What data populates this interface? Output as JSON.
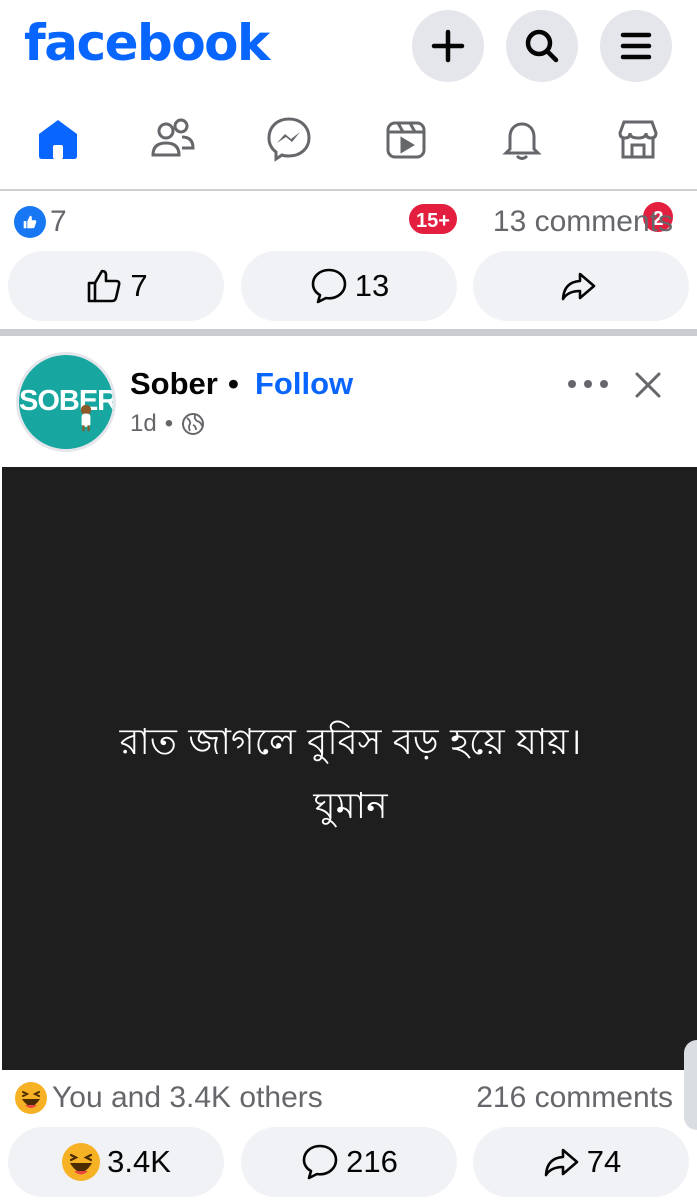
{
  "app": {
    "logo": "facebook"
  },
  "nav": {
    "reels_badge": "15+",
    "marketplace_badge": "2"
  },
  "prev_post": {
    "like_count": "7",
    "comments": "13 comments",
    "like_button": "7",
    "comment_button": "13"
  },
  "post": {
    "author": "Sober",
    "separator": "•",
    "follow": "Follow",
    "time": "1d",
    "meta_sep": "•",
    "avatar_text": "SOBER",
    "image_line1": "রাত জাগলে বুবিস বড় হয়ে যায়।",
    "image_line2": "ঘুমান",
    "reactions_summary": "You and 3.4K others",
    "comments": "216 comments",
    "reaction_button": "3.4K",
    "comment_button": "216",
    "share_button": "74"
  },
  "colors": {
    "brand": "#0866ff",
    "badge": "#e41e3f",
    "pill_bg": "#f0f2f5",
    "image_bg": "#1e1e1e"
  }
}
